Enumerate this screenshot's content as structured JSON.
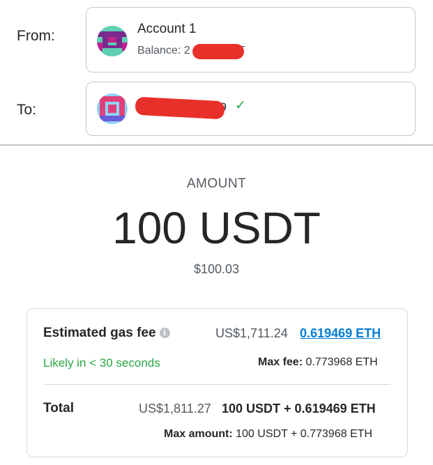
{
  "from": {
    "label": "From:",
    "account_name": "Account 1",
    "balance_prefix": "Balance: 2",
    "balance_suffix": "DT"
  },
  "to": {
    "label": "To:",
    "address_tail": "09",
    "verified_icon": "checkmark-icon"
  },
  "amount": {
    "label": "AMOUNT",
    "value": "100 USDT",
    "fiat": "$100.03"
  },
  "gas": {
    "label": "Estimated gas fee",
    "info_icon": "info-icon",
    "fiat": "US$1,711.24",
    "eth": "0.619469 ETH",
    "timing": "Likely in < 30 seconds",
    "max_fee_label": "Max fee:",
    "max_fee_value": "0.773968 ETH"
  },
  "total": {
    "label": "Total",
    "fiat": "US$1,811.27",
    "value": "100 USDT + 0.619469 ETH",
    "max_amount_label": "Max amount:",
    "max_amount_value": "100 USDT + 0.773968 ETH"
  },
  "colors": {
    "link": "#037dd6",
    "success": "#28a745",
    "redaction": "#e8302a"
  }
}
